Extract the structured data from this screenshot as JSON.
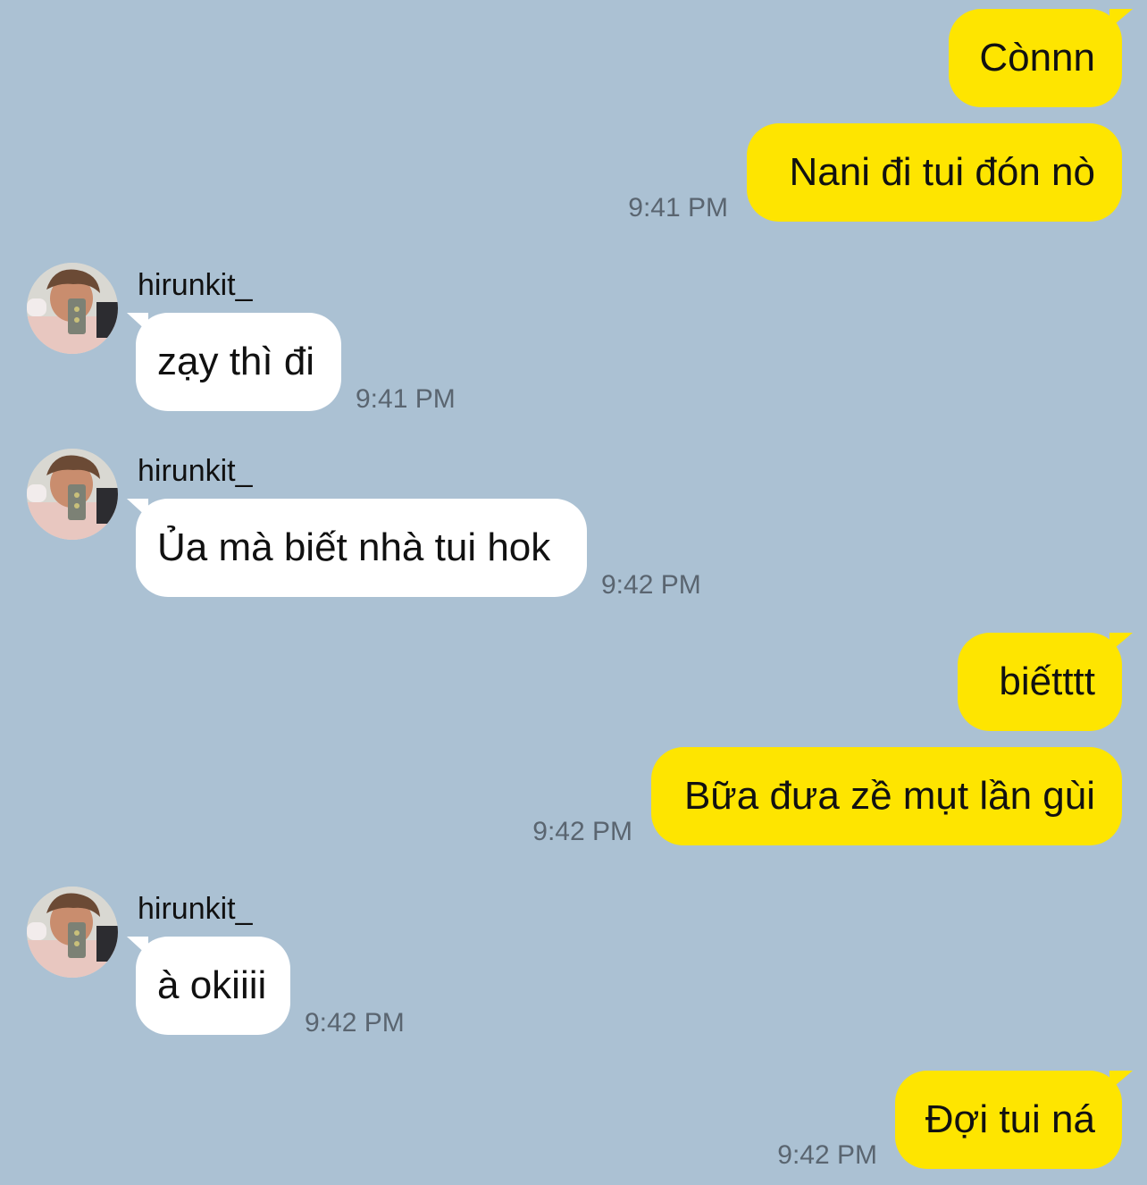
{
  "contact": {
    "name": "hirunkit_",
    "avatar_icon": "profile-photo"
  },
  "colors": {
    "background": "#abc1d3",
    "outgoing_bubble": "#fee500",
    "incoming_bubble": "#ffffff",
    "timestamp": "#5a6570"
  },
  "messages": [
    {
      "direction": "outgoing",
      "text": "Cònnn",
      "time": ""
    },
    {
      "direction": "outgoing",
      "text": "Nani đi tui đón nò",
      "time": "9:41 PM"
    },
    {
      "direction": "incoming",
      "sender": "hirunkit_",
      "text": "zạy thì đi",
      "time": "9:41 PM"
    },
    {
      "direction": "incoming",
      "sender": "hirunkit_",
      "text": "Ủa mà biết nhà tui hok",
      "time": "9:42 PM"
    },
    {
      "direction": "outgoing",
      "text": "biếtttt",
      "time": ""
    },
    {
      "direction": "outgoing",
      "text": "Bữa đưa zề mụt lần gùi",
      "time": "9:42 PM"
    },
    {
      "direction": "incoming",
      "sender": "hirunkit_",
      "text": "à okiiii",
      "time": "9:42 PM"
    },
    {
      "direction": "outgoing",
      "text": "Đợi tui ná",
      "time": "9:42 PM"
    }
  ]
}
